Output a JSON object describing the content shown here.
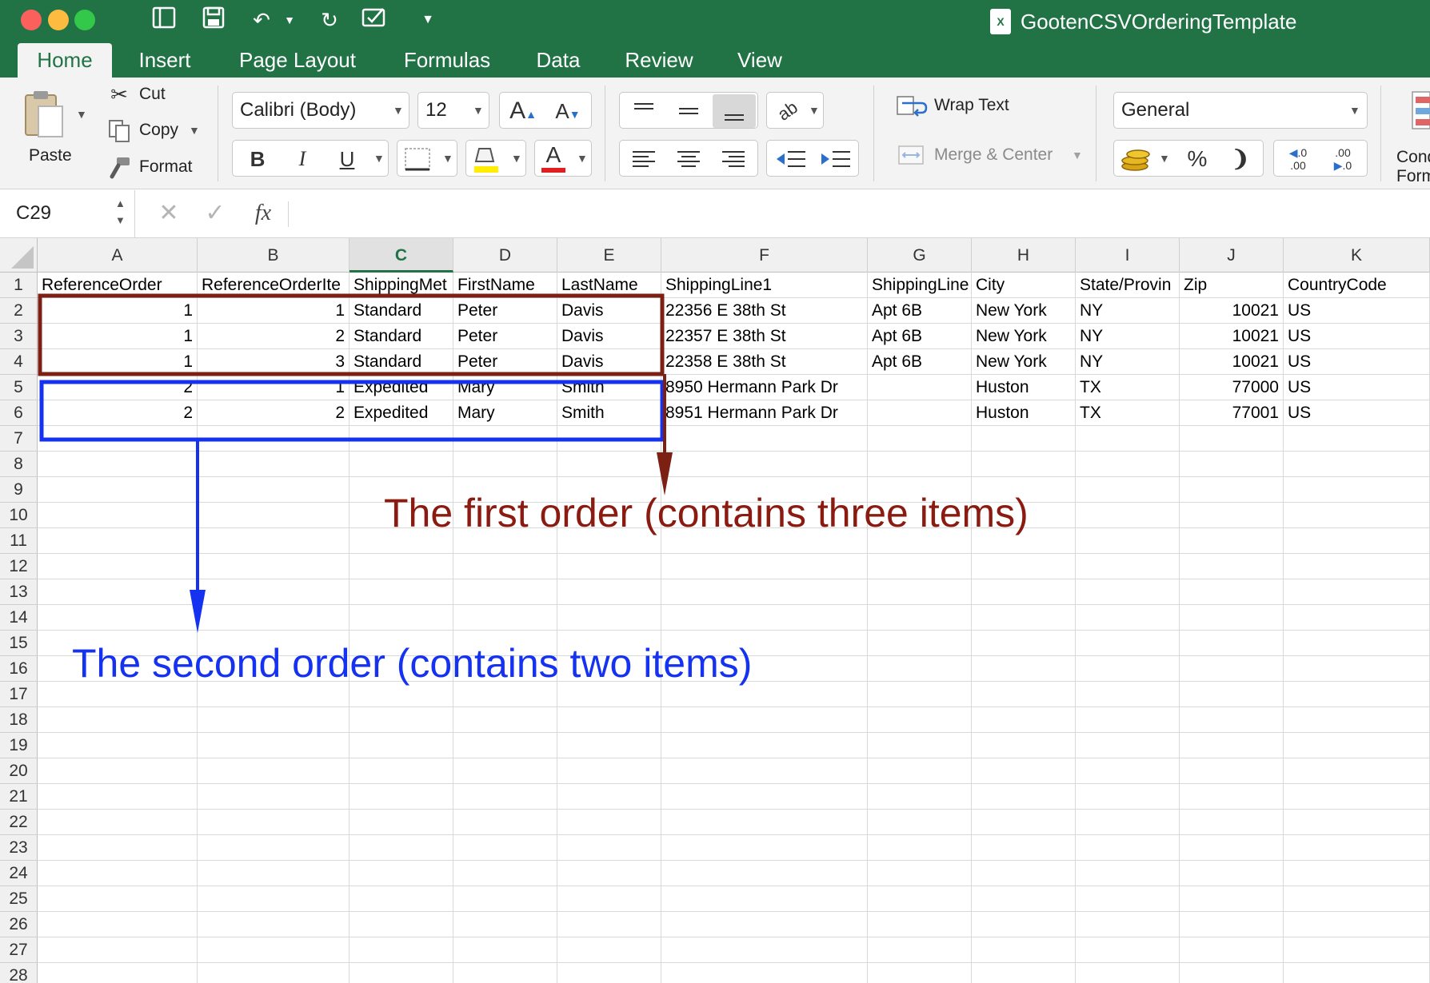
{
  "window": {
    "title": "GootenCSVOrderingTemplate",
    "traffic_colors": [
      "#fc605c",
      "#fdbc40",
      "#34c84a"
    ]
  },
  "tabs": [
    {
      "label": "Home",
      "active": true
    },
    {
      "label": "Insert"
    },
    {
      "label": "Page Layout"
    },
    {
      "label": "Formulas"
    },
    {
      "label": "Data"
    },
    {
      "label": "Review"
    },
    {
      "label": "View"
    }
  ],
  "ribbon": {
    "paste_label": "Paste",
    "cut_label": "Cut",
    "copy_label": "Copy",
    "format_label": "Format",
    "font_name": "Calibri (Body)",
    "font_size": "12",
    "bold": "B",
    "italic": "I",
    "underline": "U",
    "wrap_text_label": "Wrap Text",
    "merge_center_label": "Merge & Center",
    "number_format": "General",
    "percent": "%",
    "cond_format_label_1": "Cond",
    "cond_format_label_2": "Form"
  },
  "formula_bar": {
    "name_box": "C29",
    "fx": "fx",
    "value": ""
  },
  "sheet": {
    "selected_column": "C",
    "columns": [
      "A",
      "B",
      "C",
      "D",
      "E",
      "F",
      "G",
      "H",
      "I",
      "J",
      "K"
    ],
    "rows": [
      [
        "ReferenceOrder",
        "ReferenceOrderIte",
        "ShippingMet",
        "FirstName",
        "LastName",
        "ShippingLine1",
        "ShippingLine",
        "City",
        "State/Provin",
        "Zip",
        "CountryCode"
      ],
      [
        "1",
        "1",
        "Standard",
        "Peter",
        "Davis",
        "22356 E 38th St",
        "Apt 6B",
        "New York",
        "NY",
        "10021",
        "US"
      ],
      [
        "1",
        "2",
        "Standard",
        "Peter",
        "Davis",
        "22357 E 38th St",
        "Apt 6B",
        "New York",
        "NY",
        "10021",
        "US"
      ],
      [
        "1",
        "3",
        "Standard",
        "Peter",
        "Davis",
        "22358 E 38th St",
        "Apt 6B",
        "New York",
        "NY",
        "10021",
        "US"
      ],
      [
        "2",
        "1",
        "Expedited",
        "Mary",
        "Smith",
        "8950 Hermann Park Dr",
        "",
        "Huston",
        "TX",
        "77000",
        "US"
      ],
      [
        "2",
        "2",
        "Expedited",
        "Mary",
        "Smith",
        "8951 Hermann Park Dr",
        "",
        "Huston",
        "TX",
        "77001",
        "US"
      ]
    ],
    "numeric_columns": [
      0,
      1,
      9
    ],
    "row_count": 28
  },
  "annotations": {
    "first_order": {
      "text": "The first order (contains three items)",
      "color": "#8b1a10"
    },
    "second_order": {
      "text": "The second order (contains two items)",
      "color": "#1432f0"
    }
  }
}
